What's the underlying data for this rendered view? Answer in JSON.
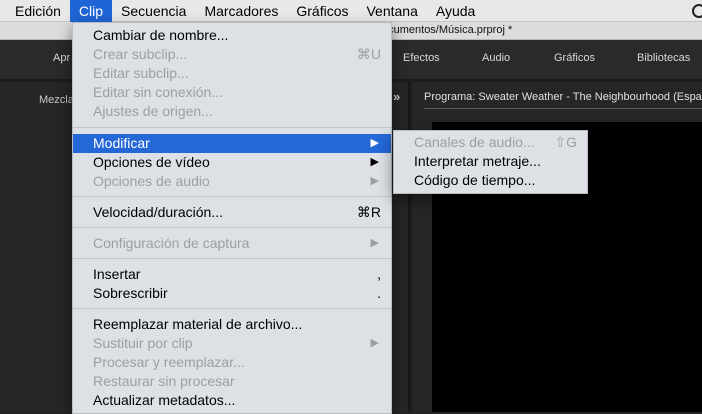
{
  "menubar": {
    "items": [
      "Edición",
      "Clip",
      "Secuencia",
      "Marcadores",
      "Gráficos",
      "Ventana",
      "Ayuda"
    ],
    "active": "Clip"
  },
  "titlebar": {
    "text": "ocumentos/Música.prproj *"
  },
  "workspace": {
    "items": [
      "Apr",
      "Efectos",
      "Audio",
      "Gráficos",
      "Bibliotecas"
    ]
  },
  "panels": {
    "left_label": "Mezcla",
    "chevrons": "»",
    "program_label": "Programa: Sweater Weather - The Neighbourhood (Españ"
  },
  "clip_menu": {
    "items": [
      {
        "label": "Cambiar de nombre...",
        "shortcut": "",
        "disabled": false
      },
      {
        "label": "Crear subclip...",
        "shortcut": "⌘U",
        "disabled": true
      },
      {
        "label": "Editar subclip...",
        "shortcut": "",
        "disabled": true
      },
      {
        "label": "Editar sin conexión...",
        "shortcut": "",
        "disabled": true
      },
      {
        "label": "Ajustes de origen...",
        "shortcut": "",
        "disabled": true
      },
      {
        "label": "Modificar",
        "shortcut": "▶",
        "disabled": false,
        "highlighted": true
      },
      {
        "label": "Opciones de vídeo",
        "shortcut": "▶",
        "disabled": false
      },
      {
        "label": "Opciones de audio",
        "shortcut": "▶",
        "disabled": true
      },
      {
        "label": "Velocidad/duración...",
        "shortcut": "⌘R",
        "disabled": false
      },
      {
        "label": "Configuración de captura",
        "shortcut": "▶",
        "disabled": true
      },
      {
        "label": "Insertar",
        "shortcut": ",",
        "disabled": false
      },
      {
        "label": "Sobrescribir",
        "shortcut": ".",
        "disabled": false
      },
      {
        "label": "Reemplazar material de archivo...",
        "shortcut": "",
        "disabled": false
      },
      {
        "label": "Sustituir por clip",
        "shortcut": "▶",
        "disabled": true
      },
      {
        "label": "Procesar y reemplazar...",
        "shortcut": "",
        "disabled": true
      },
      {
        "label": "Restaurar sin procesar",
        "shortcut": "",
        "disabled": true
      },
      {
        "label": "Actualizar metadatos...",
        "shortcut": "",
        "disabled": false
      }
    ]
  },
  "modificar_submenu": {
    "items": [
      {
        "label": "Canales de audio...",
        "shortcut": "⇧G",
        "disabled": true
      },
      {
        "label": "Interpretar metraje...",
        "shortcut": "",
        "disabled": false
      },
      {
        "label": "Código de tiempo...",
        "shortcut": "",
        "disabled": false
      }
    ]
  },
  "colors": {
    "highlight": "#2468d8",
    "menu_bg": "#dde1e6",
    "disabled_text": "#9b9fa4"
  }
}
